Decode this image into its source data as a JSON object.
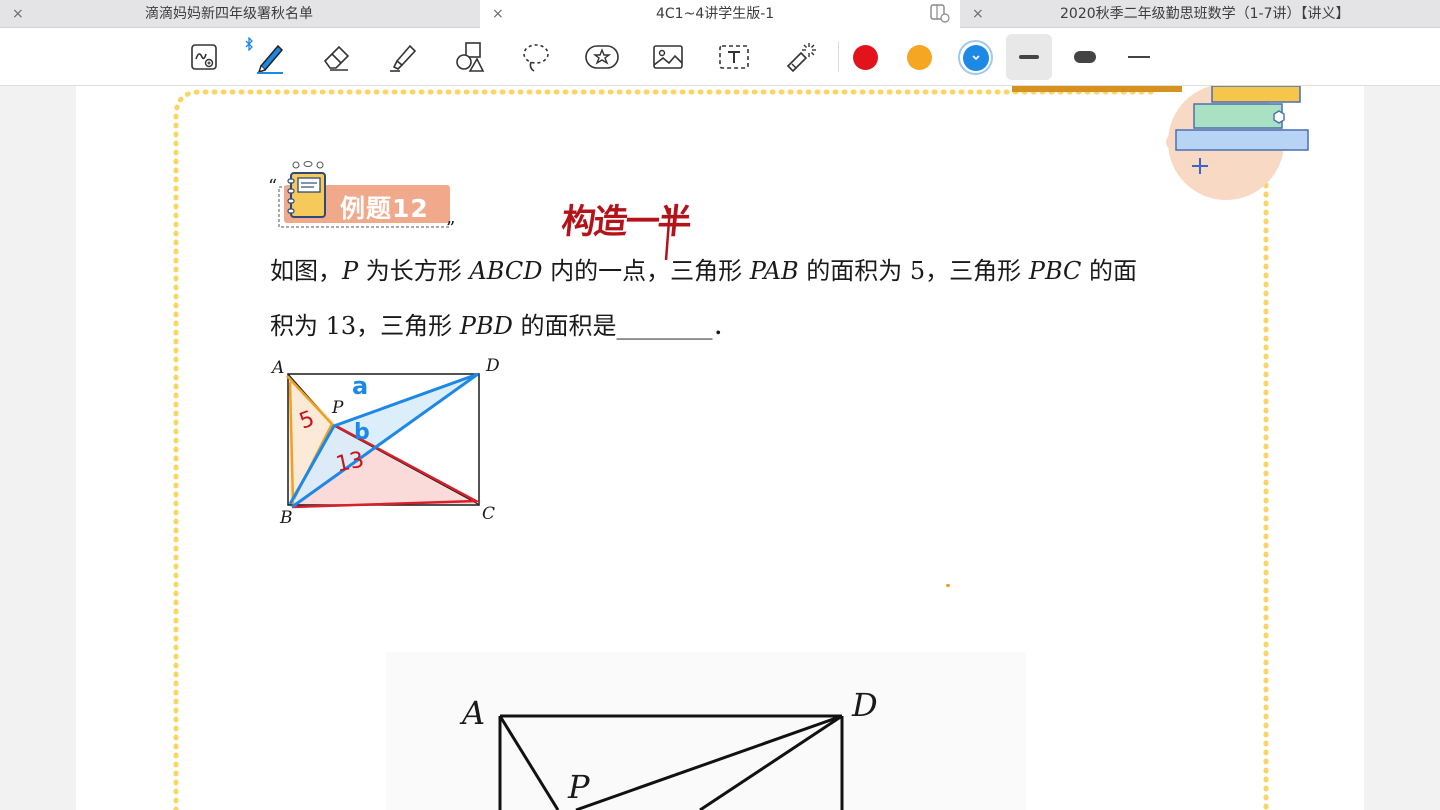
{
  "tabs": [
    {
      "title": "滴滴妈妈新四年级署秋名单",
      "active": false
    },
    {
      "title": "4C1~4讲学生版-1",
      "active": true
    },
    {
      "title": "2020秋季二年级勤思班数学（1-7讲）【讲义】",
      "active": false
    }
  ],
  "tab_close_glyph": "×",
  "toolbar": {
    "tools": [
      "zoom-pen-icon",
      "pen-icon",
      "eraser-icon",
      "highlighter-icon",
      "shapes-icon",
      "lasso-icon",
      "sticker-icon",
      "image-icon",
      "text-icon",
      "laser-pointer-icon"
    ],
    "colors": [
      "#e3131b",
      "#f5a623",
      "#1e88e5"
    ],
    "selected_color": "#1e88e5",
    "pen_connected_indicator": "bluetooth-icon"
  },
  "example": {
    "label": "例题12",
    "quote_open": "“",
    "quote_close": "”"
  },
  "question": {
    "l1_a": "如图，",
    "l1_P": "P",
    "l1_b": " 为长方形 ",
    "l1_ABCD": "ABCD",
    "l1_c": " 内的一点，三角形 ",
    "l1_PAB": "PAB",
    "l1_d": " 的面积为 5，三角形 ",
    "l1_PBC": "PBC",
    "l1_e": " 的面",
    "l2_a": "积为 13，三角形 ",
    "l2_PBD": "PBD",
    "l2_b": " 的面积是",
    "l2_blank": "________",
    "l2_c": "．"
  },
  "figure_small": {
    "vertex_labels": {
      "A": "A",
      "B": "B",
      "C": "C",
      "D": "D",
      "P": "P"
    },
    "annotations": {
      "area_pab": "5",
      "area_pbc": "13",
      "part_a": "a",
      "part_b": "b"
    }
  },
  "handwriting": {
    "note": "构造一半"
  },
  "figure_large": {
    "vertex_labels": {
      "A": "A",
      "D": "D",
      "P": "P"
    }
  }
}
